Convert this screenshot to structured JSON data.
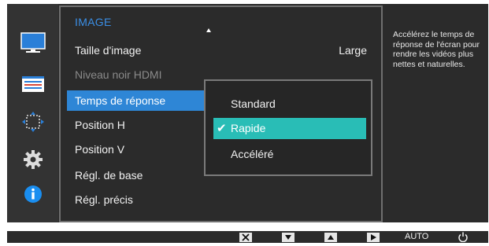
{
  "menu": {
    "title": "IMAGE",
    "items": [
      {
        "label": "Taille d'image",
        "value": "Large",
        "state": "normal"
      },
      {
        "label": "Niveau noir HDMI",
        "state": "disabled"
      },
      {
        "label": "Temps de réponse",
        "state": "selected"
      },
      {
        "label": "Position H",
        "state": "normal"
      },
      {
        "label": "Position V",
        "state": "normal"
      },
      {
        "label": "Régl. de base",
        "state": "normal"
      },
      {
        "label": "Régl. précis",
        "state": "normal"
      }
    ]
  },
  "submenu": {
    "options": [
      {
        "label": "Standard"
      },
      {
        "label": "Rapide",
        "checked": true
      },
      {
        "label": "Accéléré"
      }
    ]
  },
  "help": {
    "text": "Accélérez le temps de réponse de l'écran pour rendre les vidéos plus nettes et naturelles."
  },
  "sidebar": {
    "icons": [
      "picture-icon",
      "onscreen-display-icon",
      "position-icon",
      "settings-gear-icon",
      "information-icon"
    ]
  },
  "bottom_bar": {
    "buttons": [
      "close-icon",
      "down-icon",
      "up-icon",
      "enter-icon"
    ],
    "auto_label": "AUTO",
    "power": "power-icon"
  },
  "colors": {
    "highlight": "#2e86d6",
    "submenu_highlight": "#29bdb6",
    "title": "#3b8fe6",
    "panel": "#2b2b2b"
  }
}
